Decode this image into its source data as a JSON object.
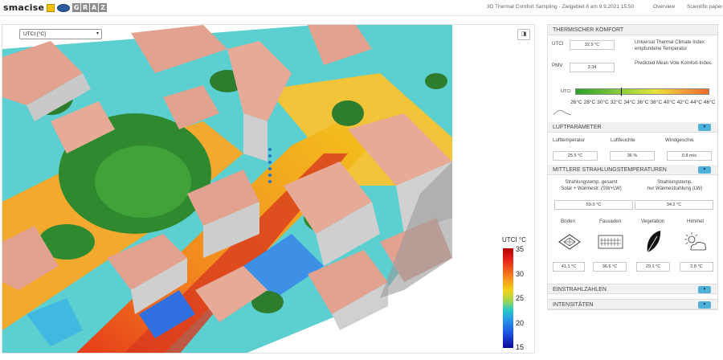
{
  "brand": {
    "name": "smacise",
    "graz": [
      "G",
      "R",
      "A",
      "Z"
    ]
  },
  "nav": {
    "title": "3D Thermal Comfort Sampling - Zielgebiet 8 am 9.9.2021 15:50",
    "links": [
      "Overview",
      "Scientific paper"
    ]
  },
  "map": {
    "layer_select": "UTCI [°C]",
    "button_icon": "layers-icon",
    "legend": {
      "title": "UTCI °C",
      "ticks": [
        "35",
        "30",
        "25",
        "20",
        "15"
      ]
    }
  },
  "panel": {
    "thermal": {
      "header": "THERMISCHER KOMFORT",
      "utci_label": "UTCI",
      "utci_value": "32.9 °C",
      "utci_desc": "Universal Thermal Climate Index empfundene Temperatur",
      "pmv_label": "PMV",
      "pmv_value": "3.34",
      "pmv_desc": "Predicted Mean Vote Komfort-Index.",
      "scale_label": "UTCI",
      "scale_ticks": "26°C 28°C 30°C 32°C 34°C 36°C 38°C 40°C 42°C 44°C 46°C",
      "marker_fraction": 0.34
    },
    "air": {
      "header": "LUFTPARAMETER",
      "labels": [
        "Lufttemperatur",
        "Luftfeuchte",
        "Windgeschw."
      ],
      "values": [
        "25.5 °C",
        "36 %",
        "0.8 m/s"
      ]
    },
    "radiation": {
      "header": "MITTLERE STRAHLUNGSTEMPERATUREN",
      "total_label_1": "Strahlungstemp. gesamt",
      "total_label_2": "Solar + Wärmestr. (SW+LW)",
      "lw_label_1": "Strahlungstemp.",
      "lw_label_2": "nur Wärmestrahlung (LW)",
      "total_value": "59.0 °C",
      "lw_value": "34.2 °C",
      "sources": [
        "Boden",
        "Fassaden",
        "Vegetation",
        "Himmel"
      ],
      "source_values": [
        "41.1 °C",
        "36.6 °C",
        "29.1 °C",
        "2.8 °C"
      ]
    },
    "einstrahl": {
      "header": "EINSTRAHLZAHLEN"
    },
    "intens": {
      "header": "INTENSITÄTEN"
    }
  }
}
